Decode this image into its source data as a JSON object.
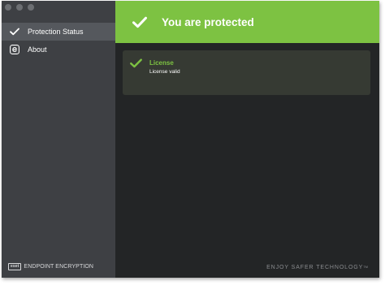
{
  "sidebar": {
    "items": [
      {
        "label": "Protection Status",
        "icon": "checkmark-icon",
        "active": true
      },
      {
        "label": "About",
        "icon": "eset-e-icon",
        "active": false
      }
    ],
    "footer_logo": "eset",
    "footer_text": "ENDPOINT ENCRYPTION"
  },
  "banner": {
    "title": "You are protected",
    "icon": "checkmark-icon",
    "color": "#7dc242"
  },
  "status_card": {
    "title": "License",
    "subtitle": "License valid",
    "icon": "checkmark-icon"
  },
  "footer": {
    "tagline": "ENJOY SAFER TECHNOLOGY",
    "trademark": "TM"
  },
  "colors": {
    "accent": "#7dc242",
    "sidebar_bg": "#3e4044",
    "main_bg": "#232526",
    "card_bg": "#363a33"
  }
}
